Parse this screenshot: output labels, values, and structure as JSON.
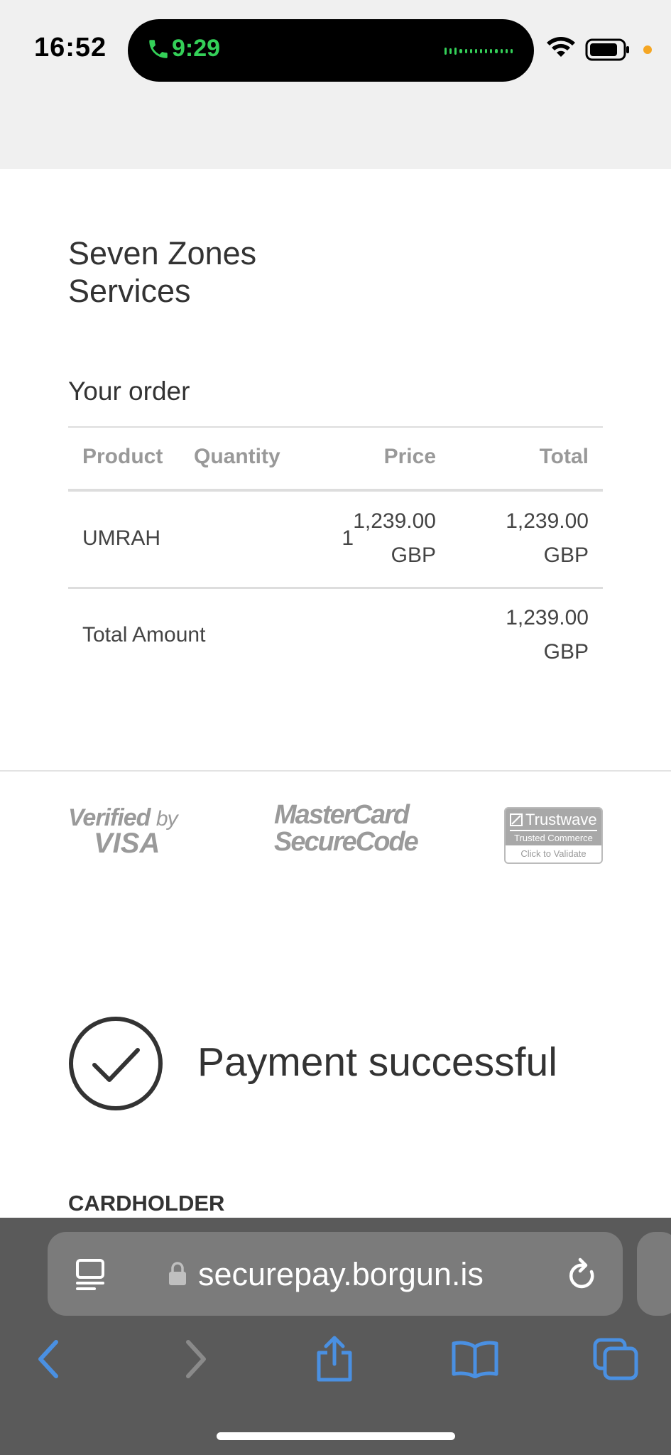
{
  "status_bar": {
    "time": "16:52",
    "call_time": "9:29",
    "call_color": "#34d058",
    "indicator_color": "#f5a623"
  },
  "merchant": {
    "name": "Seven Zones Services"
  },
  "order": {
    "title": "Your order",
    "columns": [
      "Product",
      "Quantity",
      "Price",
      "Total"
    ],
    "rows": [
      {
        "product": "UMRAH",
        "quantity": "1",
        "price_amount": "1,239.00",
        "price_currency": "GBP",
        "total_amount": "1,239.00",
        "total_currency": "GBP"
      }
    ],
    "total_label": "Total Amount",
    "total_amount": "1,239.00",
    "total_currency": "GBP"
  },
  "badges": {
    "visa_verified": "Verified",
    "visa_by": "by",
    "visa_word": "VISA",
    "mastercard_line1": "MasterCard",
    "mastercard_line2": "SecureCode",
    "trustwave_name": "Trustwave",
    "trustwave_sub": "Trusted Commerce",
    "trustwave_action": "Click to Validate"
  },
  "payment": {
    "status": "Payment successful",
    "cardholder_label": "CARDHOLDER"
  },
  "browser": {
    "url": "securepay.borgun.is",
    "accent_color": "#4a90e2",
    "icons": [
      "reader-icon",
      "lock-icon",
      "reload-icon",
      "back-icon",
      "forward-icon",
      "share-icon",
      "bookmarks-icon",
      "tabs-icon"
    ]
  }
}
